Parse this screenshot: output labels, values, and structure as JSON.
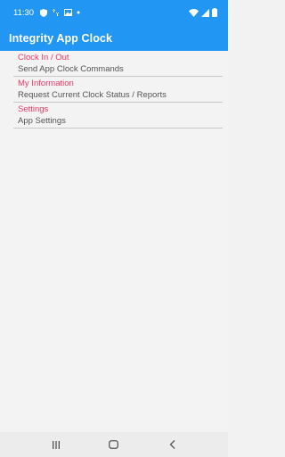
{
  "status_bar": {
    "time": "11:30",
    "icons_left": [
      "shield-icon",
      "sync-icon",
      "image-icon",
      "dot-icon"
    ],
    "icons_right": [
      "wifi-icon",
      "signal-icon",
      "battery-icon"
    ]
  },
  "app_bar": {
    "title": "Integrity App Clock"
  },
  "menu": {
    "items": [
      {
        "title": "Clock In / Out",
        "subtitle": "Send App Clock Commands"
      },
      {
        "title": "My Information",
        "subtitle": "Request Current Clock Status / Reports"
      },
      {
        "title": "Settings",
        "subtitle": "App Settings"
      }
    ]
  },
  "nav_bar": {
    "buttons": [
      "recents-icon",
      "home-icon",
      "back-icon"
    ]
  },
  "colors": {
    "primary": "#2196f3",
    "accent": "#e8396a",
    "background": "#f3f3f3",
    "subtitle_text": "#555555"
  }
}
